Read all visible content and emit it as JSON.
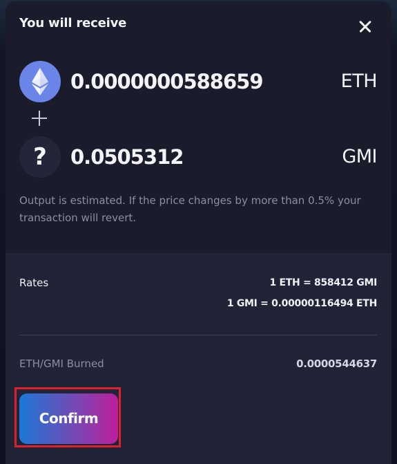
{
  "modal": {
    "title": "You will receive",
    "close_icon": "close-icon"
  },
  "receive": {
    "tokens": [
      {
        "amount": "0.0000000588659",
        "symbol": "ETH",
        "icon": "ethereum-icon"
      },
      {
        "amount": "0.0505312",
        "symbol": "GMI",
        "icon": "question-mark-icon",
        "icon_glyph": "?"
      }
    ],
    "plus_icon": "plus-icon",
    "note": "Output is estimated. If the price changes by more than 0.5% your transaction will revert."
  },
  "details": {
    "rates_label": "Rates",
    "rate_1": "1 ETH = 858412 GMI",
    "rate_2": "1 GMI = 0.00000116494 ETH",
    "burned_label": "ETH/GMI Burned",
    "burned_value": "0.0000544637"
  },
  "actions": {
    "confirm_label": "Confirm"
  },
  "colors": {
    "modal_bg": "#1a1c2c",
    "details_bg": "#212436",
    "eth_icon_bg": "#6b84e8",
    "confirm_gradient_start": "#1b78d6",
    "confirm_gradient_end": "#c01e9c",
    "highlight_border": "#e0202c"
  }
}
